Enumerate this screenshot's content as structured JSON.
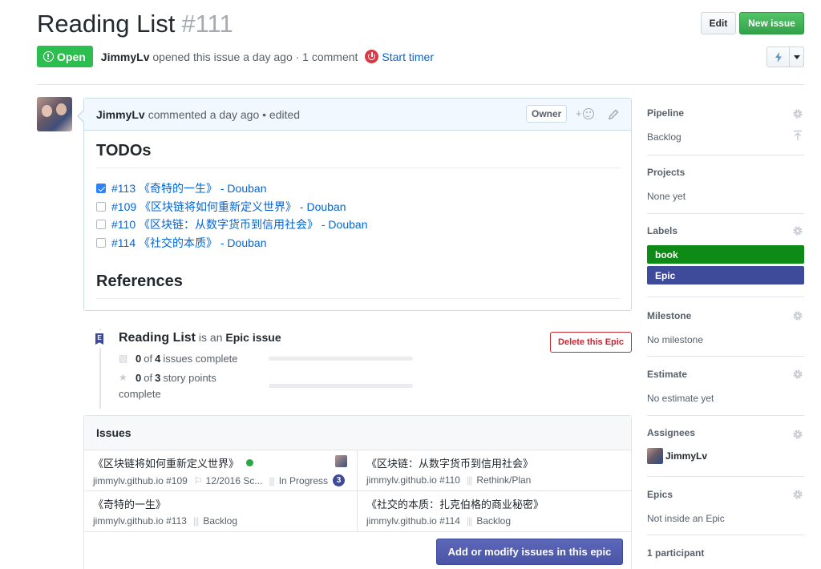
{
  "header": {
    "title": "Reading List",
    "number": "#111",
    "edit_label": "Edit",
    "new_issue_label": "New issue",
    "state": "Open",
    "author": "JimmyLv",
    "opened_text": "opened this issue a day ago · 1 comment",
    "start_timer_label": "Start timer"
  },
  "comment": {
    "author": "JimmyLv",
    "meta": "commented a day ago • edited",
    "owner_badge": "Owner",
    "react_plus": "+",
    "h_todos": "TODOs",
    "todos": [
      {
        "text": "#113 《奇特的一生》 - Douban",
        "checked": true
      },
      {
        "text": "#109 《区块链将如何重新定义世界》 - Douban",
        "checked": false
      },
      {
        "text": "#110 《区块链：从数字货币到信用社会》 - Douban",
        "checked": false
      },
      {
        "text": "#114 《社交的本质》 - Douban",
        "checked": false
      }
    ],
    "h_refs": "References"
  },
  "epic": {
    "icon_letter": "E",
    "title": "Reading List",
    "is_an": "is an",
    "epic_issue": "Epic issue",
    "delete_label": "Delete this Epic",
    "issues_done": "0",
    "issues_of": "of",
    "issues_total": "4",
    "issues_suffix": "issues complete",
    "issues_progress": 0,
    "points_done": "0",
    "points_of": "of",
    "points_total": "3",
    "points_suffix": "story points",
    "points_progress": 0,
    "complete_label": "complete"
  },
  "issues": {
    "heading": "Issues",
    "items": [
      {
        "title": "《区块链将如何重新定义世界》",
        "repo": "jimmylv.github.io #109",
        "milestone": "12/2016 Sc...",
        "pipeline": "In Progress",
        "estimate": "3",
        "open_dot": true,
        "has_avatar": true
      },
      {
        "title": "《区块链：从数字货币到信用社会》",
        "repo": "jimmylv.github.io #110",
        "pipeline": "Rethink/Plan"
      },
      {
        "title": "《奇特的一生》",
        "repo": "jimmylv.github.io #113",
        "pipeline": "Backlog"
      },
      {
        "title": "《社交的本质：扎克伯格的商业秘密》",
        "repo": "jimmylv.github.io #114",
        "pipeline": "Backlog"
      }
    ],
    "add_label": "Add or modify issues in this epic"
  },
  "sidebar": {
    "pipeline_label": "Pipeline",
    "pipeline_value": "Backlog",
    "projects_label": "Projects",
    "projects_value": "None yet",
    "labels_label": "Labels",
    "labels": [
      {
        "name": "book",
        "color": "#0e8a16"
      },
      {
        "name": "Epic",
        "color": "#3e4a9a"
      }
    ],
    "milestone_label": "Milestone",
    "milestone_value": "No milestone",
    "estimate_label": "Estimate",
    "estimate_value": "No estimate yet",
    "assignees_label": "Assignees",
    "assignee": "JimmyLv",
    "epics_label": "Epics",
    "epics_value": "Not inside an Epic",
    "participants": "1 participant"
  },
  "colors": {
    "open_green": "#2cbe4e",
    "new_issue_green": "#33a14a",
    "link_blue": "#0366d6",
    "epic_indigo": "#3e4a9a",
    "danger_red": "#cb2431"
  }
}
